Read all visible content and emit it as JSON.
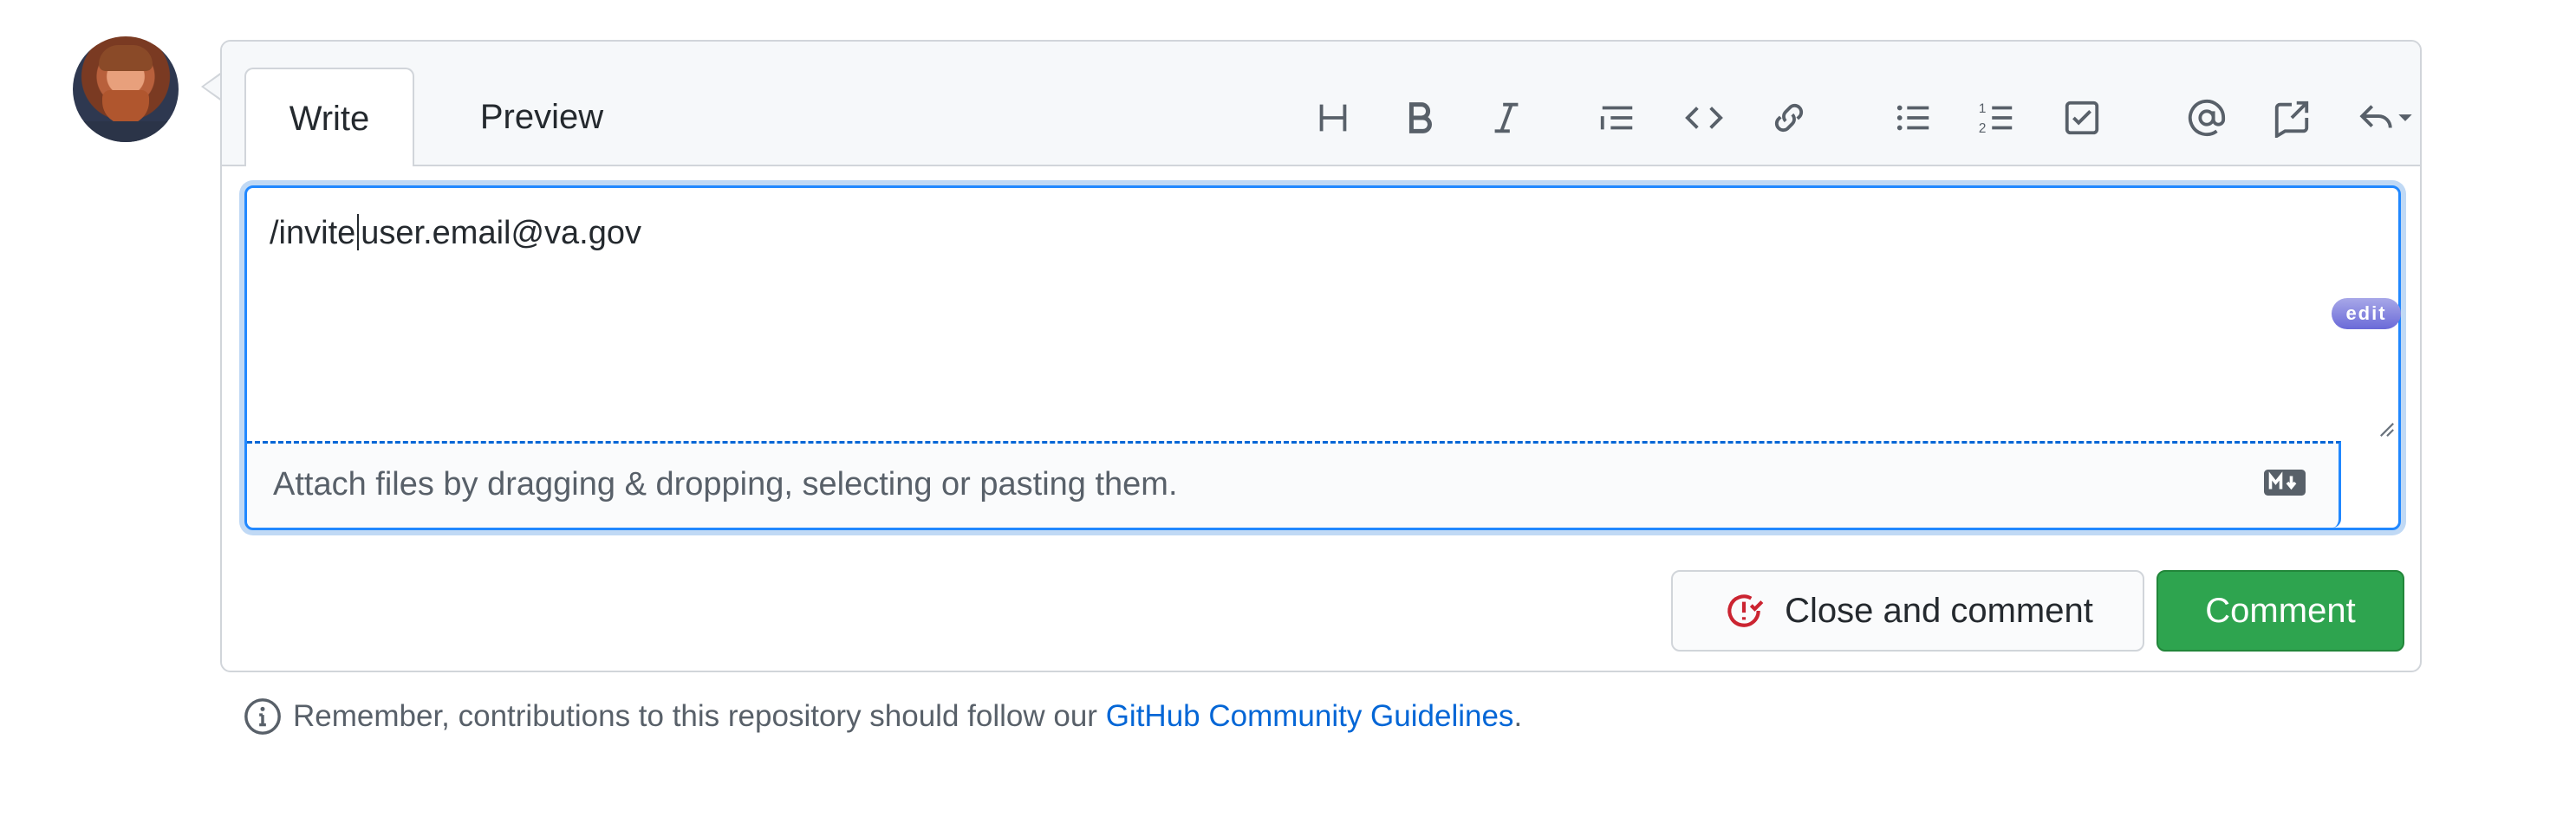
{
  "tabs": {
    "write": "Write",
    "preview": "Preview"
  },
  "toolbar": {
    "icons": [
      "heading-icon",
      "bold-icon",
      "italic-icon",
      "quote-icon",
      "code-icon",
      "link-icon",
      "bulleted-list-icon",
      "numbered-list-icon",
      "task-list-icon",
      "mention-icon",
      "reference-icon",
      "reply-icon"
    ]
  },
  "editor": {
    "text_before_cursor": "/invite",
    "text_after_cursor": "user.email@va.gov",
    "attach_text": "Attach files by dragging & dropping, selecting or pasting them.",
    "edit_badge": "edit"
  },
  "buttons": {
    "close_and_comment": "Close and comment",
    "comment": "Comment"
  },
  "footer": {
    "text": "Remember, contributions to this repository should follow our ",
    "link": "GitHub Community Guidelines",
    "suffix": "."
  },
  "colors": {
    "accent": "#0366d6",
    "focus": "#2188ff",
    "comment_button": "#2ea44f",
    "close_icon": "#cb2431"
  }
}
